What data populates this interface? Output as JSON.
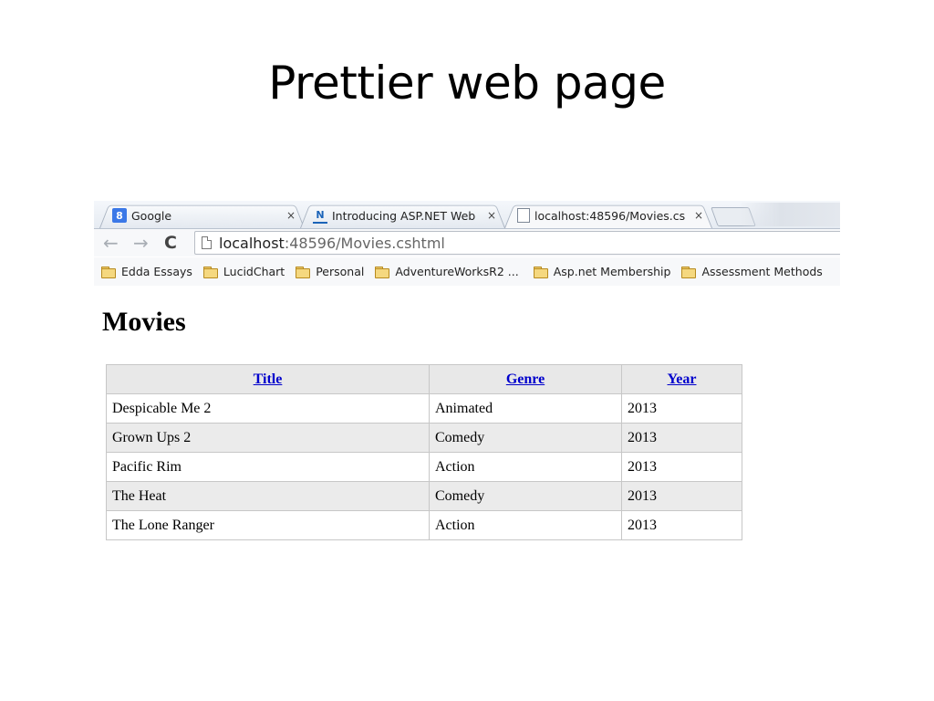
{
  "slide": {
    "title": "Prettier web page"
  },
  "browser": {
    "tabs": [
      {
        "label": "Google",
        "icon": "google-favicon",
        "close": "×"
      },
      {
        "label": "Introducing ASP.NET Web",
        "icon": "aspnet-favicon",
        "close": "×"
      },
      {
        "label": "localhost:48596/Movies.cs",
        "icon": "page-favicon",
        "close": "×",
        "active": true
      }
    ],
    "nav": {
      "back": "←",
      "forward": "→",
      "reload": "C"
    },
    "address": {
      "host": "localhost",
      "rest": ":48596/Movies.cshtml"
    },
    "bookmarks": [
      {
        "label": "Edda Essays"
      },
      {
        "label": "LucidChart"
      },
      {
        "label": "Personal"
      },
      {
        "label": "AdventureWorksR2 ..."
      },
      {
        "label": "Asp.net Membership"
      },
      {
        "label": "Assessment Methods"
      }
    ]
  },
  "page": {
    "heading": "Movies",
    "table": {
      "headers": [
        "Title",
        "Genre",
        "Year"
      ],
      "rows": [
        [
          "Despicable Me 2",
          "Animated",
          "2013"
        ],
        [
          "Grown Ups 2",
          "Comedy",
          "2013"
        ],
        [
          "Pacific Rim",
          "Action",
          "2013"
        ],
        [
          "The Heat",
          "Comedy",
          "2013"
        ],
        [
          "The Lone Ranger",
          "Action",
          "2013"
        ]
      ]
    }
  },
  "colors": {
    "link": "#0000cc",
    "header_bg": "#e8e8e8",
    "alt_row_bg": "#ebebeb",
    "border": "#c7c7c7"
  }
}
